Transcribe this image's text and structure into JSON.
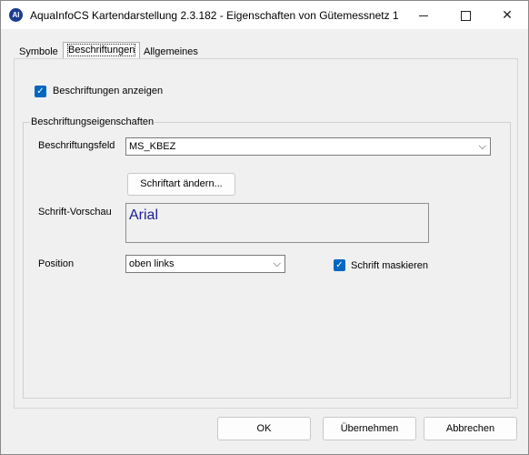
{
  "window": {
    "title": "AquaInfoCS Kartendarstellung 2.3.182  - Eigenschaften von Gütemessnetz 1",
    "icon_text": "AI",
    "controls": {
      "minimize": "minimize-icon",
      "maximize": "maximize-icon",
      "close": "close-icon"
    }
  },
  "tabs": [
    {
      "label": "Symbole",
      "active": false
    },
    {
      "label": "Beschriftungen",
      "active": true
    },
    {
      "label": "Allgemeines",
      "active": false
    }
  ],
  "show_labels": {
    "label": "Beschriftungen anzeigen",
    "checked": true
  },
  "group": {
    "title": "Beschriftungseigenschaften",
    "field_label": "Beschriftungsfeld",
    "field_value": "MS_KBEZ",
    "font_button": "Schriftart ändern...",
    "preview_label": "Schrift-Vorschau",
    "preview_text": "Arial",
    "position_label": "Position",
    "position_value": "oben links",
    "mask": {
      "label": "Schrift maskieren",
      "checked": true
    }
  },
  "buttons": {
    "ok": "OK",
    "apply": "Übernehmen",
    "cancel": "Abbrechen"
  },
  "colors": {
    "accent": "#0067c0",
    "preview_text": "#1c1c9a",
    "dialog_bg": "#f0f0f0"
  }
}
